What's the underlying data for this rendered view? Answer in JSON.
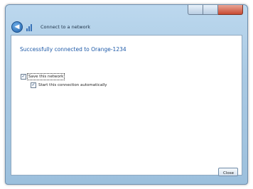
{
  "window": {
    "breadcrumb": "Connect to a network"
  },
  "main": {
    "heading": "Successfully connected to Orange-1234",
    "options": [
      {
        "label": "Save this network",
        "checked": true
      },
      {
        "label": "Start this connection automatically",
        "checked": true
      }
    ],
    "close_label": "Close"
  },
  "icons": {
    "back": "back-arrow-icon",
    "network": "network-signal-icon",
    "check": "✓",
    "back_glyph": "◀"
  },
  "colors": {
    "heading": "#1e5aa8",
    "titlebar": "#a9c9e3",
    "close_control": "#c84a32"
  }
}
